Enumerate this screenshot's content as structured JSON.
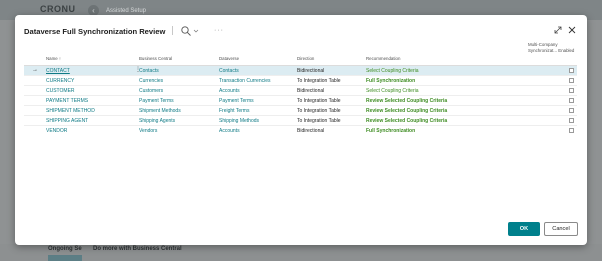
{
  "background": {
    "logo": "CRONU",
    "breadcrumb": "Assisted Setup",
    "bottom_left": "Ongoing Se",
    "bottom_mid": "Do more with Business Central"
  },
  "dialog": {
    "title": "Dataverse Full Synchronization Review",
    "ok_label": "OK",
    "cancel_label": "Cancel"
  },
  "table": {
    "headers": {
      "name": "Name ↑",
      "business_central": "Business Central",
      "dataverse": "Dataverse",
      "direction": "Direction",
      "recommendation": "Recommendation",
      "multi_company": "Multi-Company Synchronizat... Enabled"
    },
    "rows": [
      {
        "name": "CONTACT",
        "bc": "Contacts",
        "dv": "Contacts",
        "dir": "Bidirectional",
        "rec": "Select Coupling Criteria"
      },
      {
        "name": "CURRENCY",
        "bc": "Currencies",
        "dv": "Transaction Currencies",
        "dir": "To Integration Table",
        "rec": "Full Synchronization"
      },
      {
        "name": "CUSTOMER",
        "bc": "Customers",
        "dv": "Accounts",
        "dir": "Bidirectional",
        "rec": "Select Coupling Criteria"
      },
      {
        "name": "PAYMENT TERMS",
        "bc": "Payment Terms",
        "dv": "Payment Terms",
        "dir": "To Integration Table",
        "rec": "Review Selected Coupling Criteria"
      },
      {
        "name": "SHIPMENT METHOD",
        "bc": "Shipment Methods",
        "dv": "Freight Terms",
        "dir": "To Integration Table",
        "rec": "Review Selected Coupling Criteria"
      },
      {
        "name": "SHIPPING AGENT",
        "bc": "Shipping Agents",
        "dv": "Shipping Methods",
        "dir": "To Integration Table",
        "rec": "Review Selected Coupling Criteria"
      },
      {
        "name": "VENDOR",
        "bc": "Vendors",
        "dv": "Accounts",
        "dir": "Bidirectional",
        "rec": "Full Synchronization"
      }
    ]
  },
  "colors": {
    "accent": "#00808c",
    "link": "#0f7a85",
    "recommendation": "#3e8c22",
    "selected_row": "#dcecf2"
  }
}
